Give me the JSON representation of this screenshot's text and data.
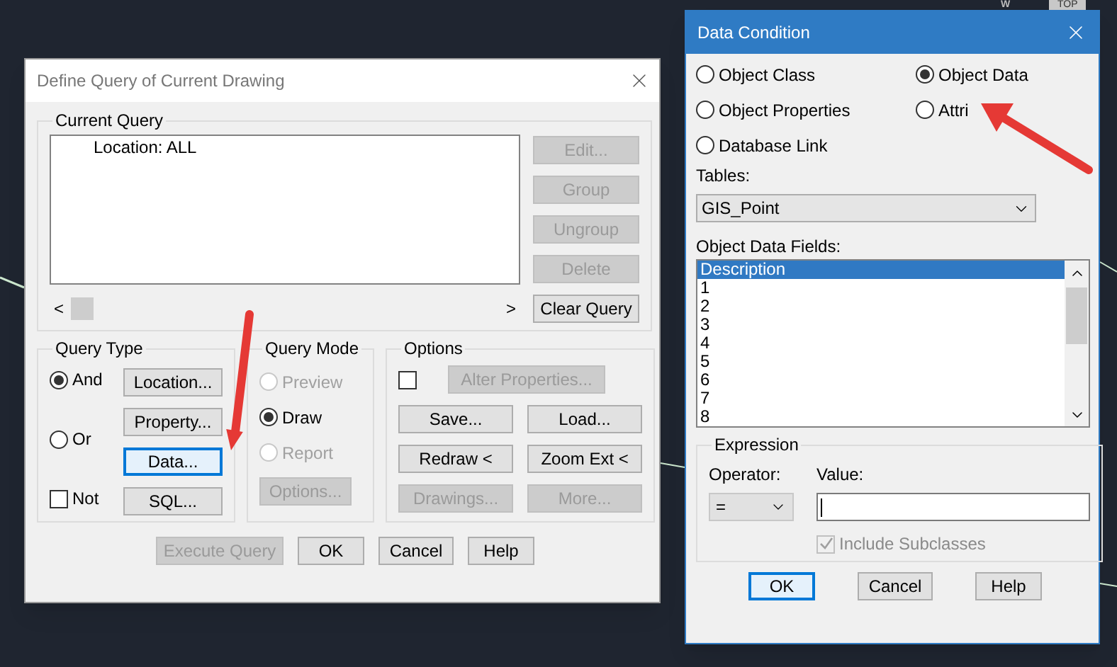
{
  "canvas": {
    "viewcube_compass": "W",
    "viewcube_face": "TOP"
  },
  "query_dialog": {
    "title": "Define Query of Current Drawing",
    "current_query": {
      "label": "Current Query",
      "items": [
        "Location: ALL"
      ],
      "scroll_left": "<",
      "scroll_right": ">",
      "buttons": [
        {
          "label": "Edit...",
          "disabled": true
        },
        {
          "label": "Group",
          "disabled": true
        },
        {
          "label": "Ungroup",
          "disabled": true
        },
        {
          "label": "Delete",
          "disabled": true
        },
        {
          "label": "Clear Query",
          "disabled": false
        }
      ]
    },
    "query_type": {
      "label": "Query Type",
      "choices": [
        {
          "kind": "radio",
          "label": "And",
          "selected": true
        },
        {
          "kind": "radio",
          "label": "Or",
          "selected": false
        },
        {
          "kind": "checkbox",
          "label": "Not",
          "checked": false
        }
      ],
      "buttons": [
        {
          "label": "Location...",
          "focused": false
        },
        {
          "label": "Property...",
          "focused": false
        },
        {
          "label": "Data...",
          "focused": true
        },
        {
          "label": "SQL...",
          "focused": false
        }
      ]
    },
    "query_mode": {
      "label": "Query Mode",
      "choices": [
        {
          "label": "Preview",
          "selected": false,
          "disabled": true
        },
        {
          "label": "Draw",
          "selected": true,
          "disabled": false
        },
        {
          "label": "Report",
          "selected": false,
          "disabled": true
        }
      ],
      "button": {
        "label": "Options...",
        "disabled": true
      }
    },
    "options": {
      "label": "Options",
      "checked": false,
      "alter_button": {
        "label": "Alter Properties...",
        "disabled": true
      },
      "buttons": [
        {
          "label": "Save...",
          "disabled": false
        },
        {
          "label": "Load...",
          "disabled": false
        },
        {
          "label": "Redraw <",
          "disabled": false
        },
        {
          "label": "Zoom Ext <",
          "disabled": false
        },
        {
          "label": "Drawings...",
          "disabled": true
        },
        {
          "label": "More...",
          "disabled": true
        }
      ]
    },
    "footer_buttons": [
      {
        "label": "Execute Query",
        "disabled": true
      },
      {
        "label": "OK",
        "disabled": false
      },
      {
        "label": "Cancel",
        "disabled": false
      },
      {
        "label": "Help",
        "disabled": false
      }
    ]
  },
  "data_dialog": {
    "title": "Data Condition",
    "sources": [
      {
        "label": "Object Class",
        "selected": false
      },
      {
        "label": "Object Data",
        "selected": true
      },
      {
        "label": "Object Properties",
        "selected": false
      },
      {
        "label": "Attri",
        "selected": false
      },
      {
        "label": "Database Link",
        "selected": false
      }
    ],
    "tables_label": "Tables:",
    "table_value": "GIS_Point",
    "fields_label": "Object Data Fields:",
    "fields": [
      {
        "label": "Description",
        "selected": true
      },
      {
        "label": "1",
        "selected": false
      },
      {
        "label": "2",
        "selected": false
      },
      {
        "label": "3",
        "selected": false
      },
      {
        "label": "4",
        "selected": false
      },
      {
        "label": "5",
        "selected": false
      },
      {
        "label": "6",
        "selected": false
      },
      {
        "label": "7",
        "selected": false
      },
      {
        "label": "8",
        "selected": false
      }
    ],
    "expression": {
      "label": "Expression",
      "operator_label": "Operator:",
      "operator_value": "=",
      "value_label": "Value:",
      "include_label": "Include Subclasses",
      "include_checked": true
    },
    "buttons": [
      {
        "label": "OK",
        "focused": true
      },
      {
        "label": "Cancel",
        "focused": false
      },
      {
        "label": "Help",
        "focused": false
      }
    ]
  }
}
